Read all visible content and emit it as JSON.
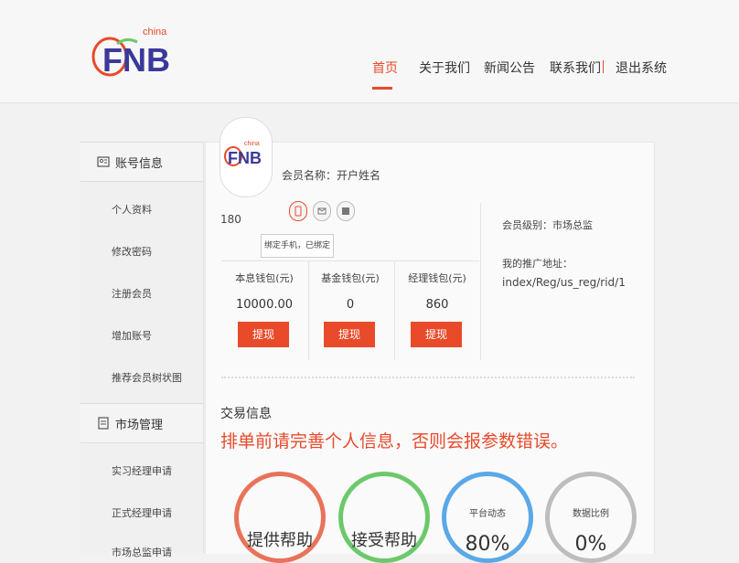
{
  "brand": {
    "logo_top": "china",
    "logo_main": "FNB",
    "accent": "#e84a2a"
  },
  "nav": {
    "items": [
      "首页",
      "关于我们",
      "新闻公告",
      "联系我们",
      "退出系统"
    ],
    "active_index": 0
  },
  "sidebar": {
    "section1": {
      "title": "账号信息",
      "icon": "user-card-icon",
      "items": [
        "个人资料",
        "修改密码",
        "注册会员",
        "增加账号",
        "推荐会员树状图"
      ]
    },
    "section2": {
      "title": "市场管理",
      "icon": "document-icon",
      "items": [
        "实习经理申请",
        "正式经理申请",
        "市场总监申请"
      ]
    }
  },
  "profile": {
    "member_name": "会员名称：开户姓名",
    "member_id": "180",
    "bind_icons": [
      "phone-icon",
      "email-icon",
      "card-icon"
    ],
    "tooltip": "绑定手机，已绑定",
    "level": "会员级别：市场总监",
    "promo_label": "我的推广地址：",
    "promo_url": "index/Reg/us_reg/rid/1"
  },
  "wallets": [
    {
      "label": "本息钱包(元)",
      "value": "10000.00",
      "button": "提现"
    },
    {
      "label": "基金钱包(元)",
      "value": "0",
      "button": "提现"
    },
    {
      "label": "经理钱包(元)",
      "value": "860",
      "button": "提现"
    }
  ],
  "trade": {
    "title": "交易信息",
    "warning": "排单前请完善个人信息，否则会报参数错误。",
    "circles": [
      {
        "title": "提供帮助",
        "color": "#e8735a"
      },
      {
        "title": "接受帮助",
        "color": "#6cc96b"
      },
      {
        "label": "平台动态",
        "value": "80%",
        "color": "#5aa8e8"
      },
      {
        "label": "数据比例",
        "value": "0%",
        "color": "#bdbdbd"
      }
    ]
  }
}
